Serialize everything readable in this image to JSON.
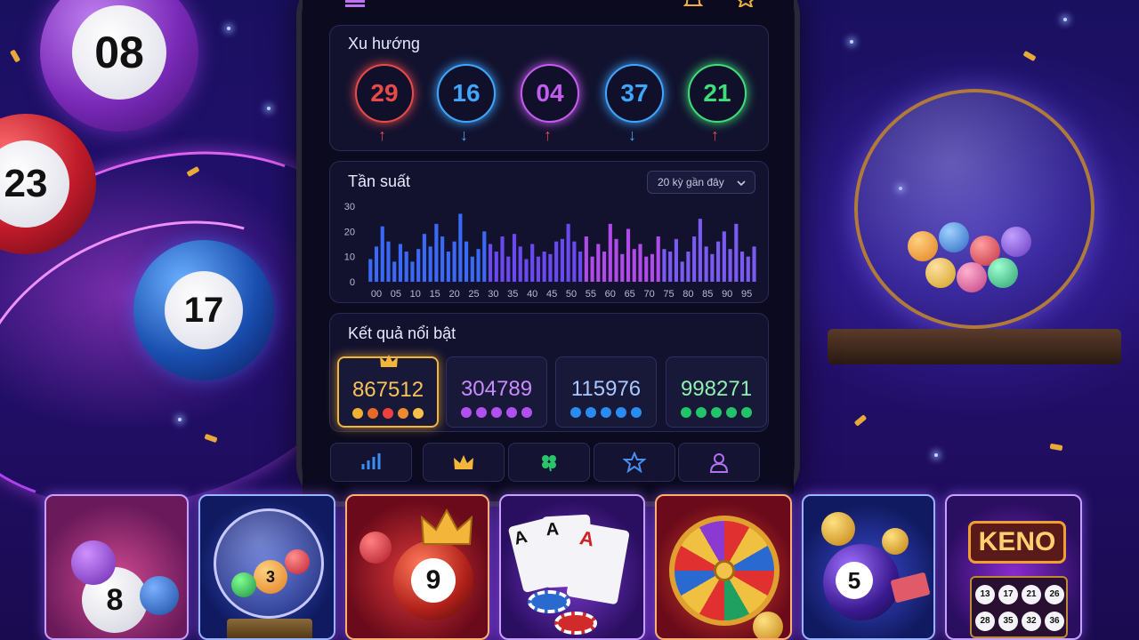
{
  "colors": {
    "up": "#e84a4a",
    "down": "#4aa7f5",
    "accent_gold": "#f3b53a",
    "panel": "#12122e"
  },
  "background_balls": [
    {
      "number": "08"
    },
    {
      "number": "23"
    },
    {
      "number": "17"
    }
  ],
  "app": {
    "menu_icon": "hamburger-icon",
    "top_icons": [
      "bell-icon",
      "star-icon"
    ],
    "trend": {
      "title": "Xu hướng",
      "items": [
        {
          "number": "29",
          "direction": "up",
          "color": "#e84a4a"
        },
        {
          "number": "16",
          "direction": "down",
          "color": "#3fa6ff"
        },
        {
          "number": "04",
          "direction": "up",
          "color": "#c45cf0"
        },
        {
          "number": "37",
          "direction": "down",
          "color": "#3fa6ff"
        },
        {
          "number": "21",
          "direction": "up",
          "color": "#3fdc7a"
        }
      ]
    },
    "frequency": {
      "title": "Tần suất",
      "dropdown": "20 kỳ gần đây"
    },
    "results": {
      "title": "Kết quả nổi bật",
      "items": [
        {
          "value": "867512",
          "color": "#f6c35a",
          "dots": [
            "#f0b030",
            "#e66a2a",
            "#ef4040",
            "#f08a30",
            "#f6c04a"
          ]
        },
        {
          "value": "304789",
          "color": "#c88cff",
          "dots": [
            "#b050f0",
            "#b050f0",
            "#b050f0",
            "#b050f0",
            "#b050f0"
          ]
        },
        {
          "value": "115976",
          "color": "#a8c8ff",
          "dots": [
            "#2a8cf0",
            "#2a8cf0",
            "#2a8cf0",
            "#2a8cf0",
            "#2a8cf0"
          ]
        },
        {
          "value": "998271",
          "color": "#8ff0b0",
          "dots": [
            "#22c46a",
            "#22c46a",
            "#22c46a",
            "#22c46a",
            "#22c46a"
          ]
        }
      ]
    },
    "nav": [
      "bar-chart-icon",
      "crown-icon",
      "clover-icon",
      "star-icon",
      "user-icon"
    ]
  },
  "chart_data": {
    "type": "bar",
    "title": "Tần suất",
    "xlabel": "",
    "ylabel": "",
    "ylim": [
      0,
      30
    ],
    "yticks": [
      "0",
      "10",
      "20",
      "30"
    ],
    "xticks": [
      "00",
      "05",
      "10",
      "15",
      "20",
      "25",
      "30",
      "35",
      "40",
      "45",
      "50",
      "55",
      "60",
      "65",
      "70",
      "75",
      "80",
      "85",
      "90",
      "95"
    ],
    "values": [
      9,
      14,
      22,
      16,
      8,
      15,
      12,
      8,
      13,
      19,
      14,
      23,
      18,
      12,
      16,
      27,
      16,
      10,
      13,
      20,
      15,
      12,
      18,
      10,
      19,
      14,
      9,
      15,
      10,
      12,
      11,
      16,
      17,
      23,
      16,
      12,
      18,
      10,
      15,
      12,
      23,
      17,
      11,
      21,
      13,
      15,
      10,
      11,
      18,
      13,
      12,
      17,
      8,
      12,
      18,
      25,
      14,
      11,
      16,
      20,
      13,
      23,
      12,
      10,
      14
    ]
  },
  "game_cards": [
    {
      "label": "8"
    },
    {
      "label": "3"
    },
    {
      "label": "9"
    },
    {
      "label": "A"
    },
    {
      "label": ""
    },
    {
      "label": "5"
    },
    {
      "label": "KENO",
      "numbers": [
        "13",
        "17",
        "21",
        "26",
        "28",
        "35",
        "32",
        "36"
      ]
    }
  ]
}
